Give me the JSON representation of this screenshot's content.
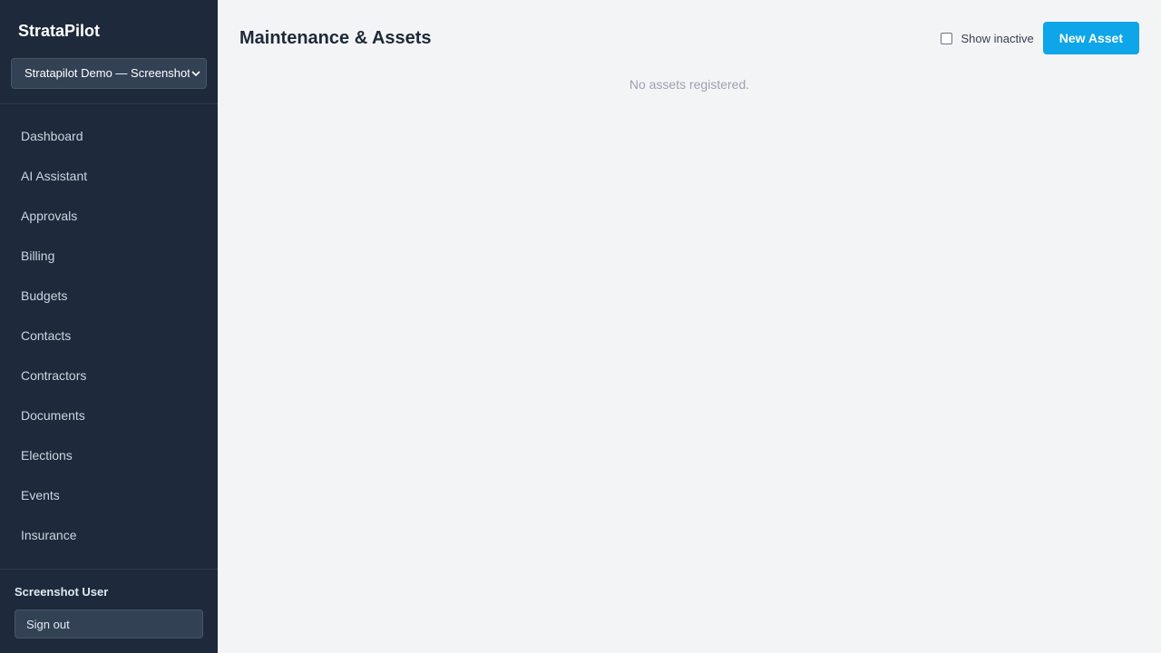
{
  "sidebar": {
    "brand": "StrataPilot",
    "org_select": {
      "value": "Stratapilot Demo — Screenshot"
    },
    "items": [
      {
        "label": "Dashboard"
      },
      {
        "label": "AI Assistant"
      },
      {
        "label": "Approvals"
      },
      {
        "label": "Billing"
      },
      {
        "label": "Budgets"
      },
      {
        "label": "Contacts"
      },
      {
        "label": "Contractors"
      },
      {
        "label": "Documents"
      },
      {
        "label": "Elections"
      },
      {
        "label": "Events"
      },
      {
        "label": "Insurance"
      }
    ],
    "user_name": "Screenshot User",
    "signout_label": "Sign out"
  },
  "main": {
    "title": "Maintenance & Assets",
    "show_inactive_label": "Show inactive",
    "show_inactive_checked": false,
    "new_asset_label": "New Asset",
    "empty_message": "No assets registered."
  },
  "colors": {
    "sidebar_bg": "#1e293b",
    "accent": "#0ea5e9",
    "page_bg": "#f3f4f6"
  }
}
